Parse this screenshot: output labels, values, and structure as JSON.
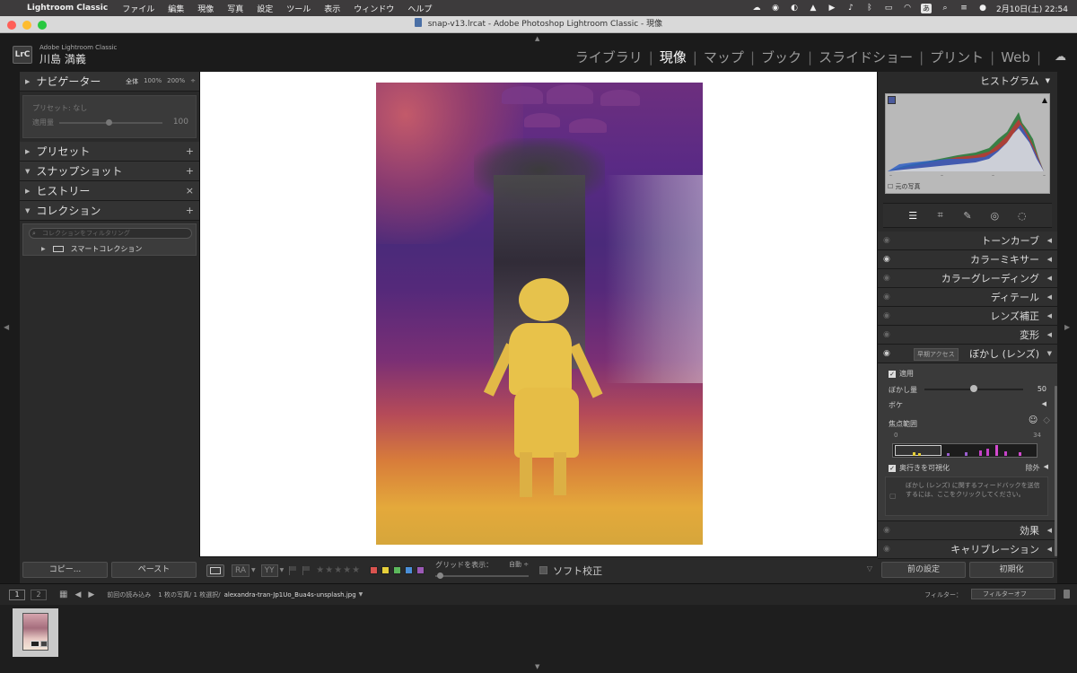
{
  "menubar": {
    "app": "Lightroom Classic",
    "items": [
      "ファイル",
      "編集",
      "現像",
      "写真",
      "設定",
      "ツール",
      "表示",
      "ウィンドウ",
      "ヘルプ"
    ],
    "ime": "あ",
    "datetime": "2月10日(土) 22:54"
  },
  "window": {
    "title": "snap-v13.lrcat - Adobe Photoshop Lightroom Classic - 現像"
  },
  "identity": {
    "small": "Adobe Lightroom Classic",
    "user": "川島 満義",
    "logo": "LrC"
  },
  "modules": [
    {
      "label": "ライブラリ",
      "active": false
    },
    {
      "label": "現像",
      "active": true
    },
    {
      "label": "マップ",
      "active": false
    },
    {
      "label": "ブック",
      "active": false
    },
    {
      "label": "スライドショー",
      "active": false
    },
    {
      "label": "プリント",
      "active": false
    },
    {
      "label": "Web",
      "active": false
    }
  ],
  "left_panel": {
    "navigator": {
      "label": "ナビゲーター",
      "zooms": [
        "全体",
        "100%",
        "200%"
      ],
      "zoom_more": "÷"
    },
    "preset_box": {
      "preset_label": "プリセット: なし",
      "amount_label": "適用量",
      "amount_value": "100",
      "amount_fraction": 0.48
    },
    "presets": {
      "label": "プリセット",
      "action": "+"
    },
    "snapshots": {
      "label": "スナップショット",
      "action": "+"
    },
    "history": {
      "label": "ヒストリー",
      "action": "×"
    },
    "collections": {
      "label": "コレクション",
      "action": "+",
      "search_placeholder": "コレクションをフィルタリング",
      "smart": "スマートコレクション"
    },
    "copy_button": "コピー...",
    "paste_button": "ペースト"
  },
  "toolbar": {
    "view_a": "RA",
    "view_b": "YY",
    "stars": "★★★★★",
    "color_labels": [
      "#d9534f",
      "#e6cf3a",
      "#5cb85c",
      "#4a8fd8",
      "#9b59b6"
    ],
    "grid_label": "グリッドを表示：",
    "grid_value": "自動 ÷",
    "soft_proof": "ソフト校正"
  },
  "right_panel": {
    "histogram": {
      "label": "ヒストグラム",
      "original_photo": "元の写真"
    },
    "sections": [
      {
        "label": "トーンカーブ",
        "eye": false
      },
      {
        "label": "カラーミキサー",
        "eye": true
      },
      {
        "label": "カラーグレーディング",
        "eye": false
      },
      {
        "label": "ディテール",
        "eye": false
      },
      {
        "label": "レンズ補正",
        "eye": false
      },
      {
        "label": "変形",
        "eye": false
      }
    ],
    "lens_blur": {
      "label": "ぼかし (レンズ)",
      "early_access": "早期アクセス",
      "apply": "適用",
      "amount_label": "ぼかし量",
      "amount_value": "50",
      "amount_fraction": 0.5,
      "bokeh": "ボケ",
      "focus_range": "焦点範囲",
      "range_min": "0",
      "range_max": "34",
      "visualize_depth": "奥行きを可視化",
      "exclude": "除外",
      "feedback": "ぼかし (レンズ) に関するフィードバックを送信するには、ここをクリックしてください。"
    },
    "bottom_sections": [
      {
        "label": "効果",
        "eye": false
      },
      {
        "label": "キャリブレーション",
        "eye": false
      }
    ],
    "prev_button": "前の設定",
    "reset_button": "初期化"
  },
  "filmstrip": {
    "page1": "1",
    "page2": "2",
    "source": "前回の読み込み",
    "count": "1 枚の写真/ 1 枚選択/",
    "filename": "alexandra-tran-Jp1Uo_Bua4s-unsplash.jpg",
    "filter_label": "フィルター：",
    "filter_value": "フィルターオフ"
  }
}
